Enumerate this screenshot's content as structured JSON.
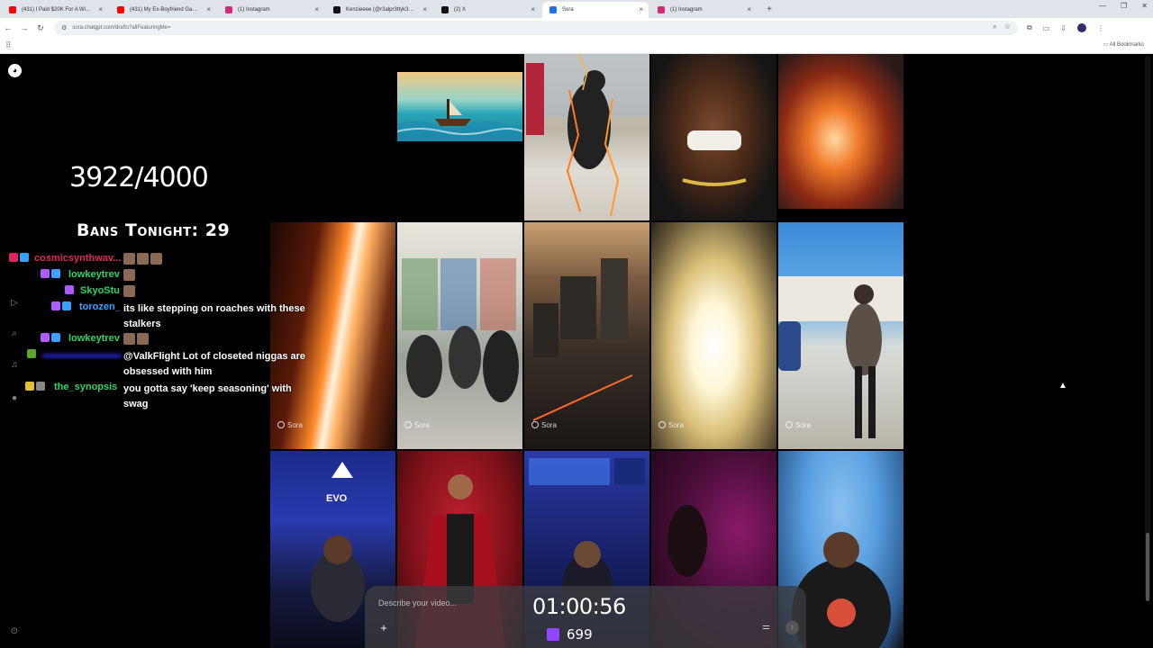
{
  "browser": {
    "tabs": [
      {
        "title": "(431) I Paid $20K For A Wife - Is...",
        "favicon": "#ff0000"
      },
      {
        "title": "(431) My Ex-Boyfriend Gave Me...",
        "favicon": "#ff0000"
      },
      {
        "title": "(1) Instagram",
        "favicon": "#d62976"
      },
      {
        "title": "Kenzieeee (@r3alpr3ttyk3nz_) |...",
        "favicon": "#111111"
      },
      {
        "title": "(2) X",
        "favicon": "#111111"
      },
      {
        "title": "Sora",
        "favicon": "#1a73e8"
      },
      {
        "title": "(1) Instagram",
        "favicon": "#d62976"
      }
    ],
    "active_tab_index": 5,
    "url": "sora.chatgpt.com/drafts?allFeaturingMe=",
    "all_bookmarks": "All Bookmarks"
  },
  "overlay": {
    "counter": "3922/4000",
    "bans_tonight": "Bans Tonight: 29",
    "timer": "01:00:56",
    "viewers": "699"
  },
  "chat": [
    {
      "user": "cosmicsynthwav...",
      "color": "#e0245e",
      "text": "",
      "emotes": 3,
      "badges": [
        "#e0245e",
        "#3aa0ff"
      ]
    },
    {
      "user": "lowkeytrev",
      "color": "#2bd46b",
      "text": "",
      "emotes": 1,
      "badges": [
        "#b05bff",
        "#3aa0ff"
      ]
    },
    {
      "user": "SkyoStu",
      "color": "#2bd46b",
      "text": "",
      "emotes": 1,
      "badges": [
        "#b05bff"
      ]
    },
    {
      "user": "torozen_",
      "color": "#3aa0ff",
      "text": "its like stepping on roaches with these stalkers",
      "emotes": 0,
      "badges": [
        "#b05bff",
        "#3aa0ff"
      ]
    },
    {
      "user": "lowkeytrev",
      "color": "#2bd46b",
      "text": "",
      "emotes": 2,
      "badges": [
        "#b05bff",
        "#3aa0ff"
      ]
    },
    {
      "user": "",
      "color": "#2b2bff",
      "text": "@ValkFlight Lot of closeted niggas are obsessed with him",
      "emotes": 0,
      "badges": [
        "#5ca82a"
      ]
    },
    {
      "user": "the_synopsis",
      "color": "#2bd46b",
      "text": "you gotta say 'keep seasoning' with swag",
      "emotes": 0,
      "badges": [
        "#e0c23a",
        "#888888"
      ]
    }
  ],
  "feed": {
    "tag_label": "Sora",
    "tiles": [
      {
        "name": "ship-on-waves"
      },
      {
        "name": "lightning-store-walk"
      },
      {
        "name": "shouting-man-closeup"
      },
      {
        "name": "fire-explosion"
      },
      {
        "name": "light-beam-flash"
      },
      {
        "name": "convenience-store-crowd"
      },
      {
        "name": "city-rooftops-aerial"
      },
      {
        "name": "white-blast"
      },
      {
        "name": "hoodie-man-parking-lot"
      },
      {
        "name": "evo-stage-gamer"
      },
      {
        "name": "anime-red-caped-man"
      },
      {
        "name": "esports-arena-player"
      },
      {
        "name": "dark-purple-room"
      },
      {
        "name": "fisheye-paris-shirt"
      }
    ]
  },
  "composer": {
    "placeholder": "Describe your video..."
  }
}
